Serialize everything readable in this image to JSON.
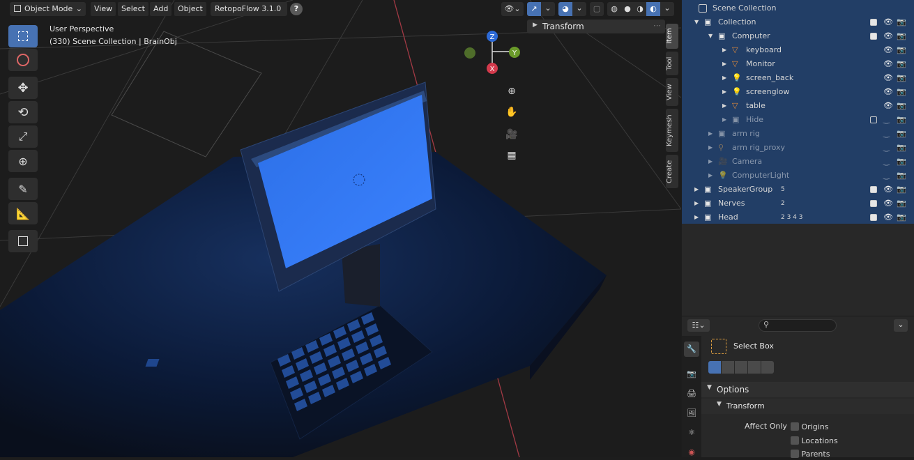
{
  "header": {
    "mode": "Object Mode",
    "menus": [
      "View",
      "Select",
      "Add",
      "Object"
    ],
    "addon": "RetopoFlow 3.1.0",
    "help_icon": "question-icon"
  },
  "overlay": {
    "perspective": "User Perspective",
    "context": "(330) Scene Collection | BrainObj"
  },
  "tools": [
    "select-box-icon",
    "cursor-icon",
    "move-icon",
    "rotate-icon",
    "scale-icon",
    "transform-icon",
    "annotate-icon",
    "measure-icon",
    "add-cube-icon"
  ],
  "gizmo": {
    "z": "Z",
    "y": "Y",
    "x": "X"
  },
  "side_tabs": [
    "Item",
    "Tool",
    "View",
    "Keymesh",
    "Create"
  ],
  "transform_panel": {
    "title": "Transform"
  },
  "outliner": {
    "root": "Scene Collection",
    "rows": [
      {
        "label": "Collection",
        "depth": 1,
        "kind": "collection",
        "checked": true,
        "dim": false
      },
      {
        "label": "Computer",
        "depth": 2,
        "kind": "collection",
        "checked": true,
        "dim": false
      },
      {
        "label": "keyboard",
        "depth": 3,
        "kind": "mesh",
        "checked": null,
        "dim": false
      },
      {
        "label": "Monitor",
        "depth": 3,
        "kind": "mesh",
        "checked": null,
        "dim": false
      },
      {
        "label": "screen_back",
        "depth": 3,
        "kind": "light",
        "checked": null,
        "dim": false
      },
      {
        "label": "screenglow",
        "depth": 3,
        "kind": "light",
        "checked": null,
        "dim": false
      },
      {
        "label": "table",
        "depth": 3,
        "kind": "mesh",
        "checked": null,
        "dim": false
      },
      {
        "label": "Hide",
        "depth": 3,
        "kind": "collection",
        "checked": false,
        "dim": true
      },
      {
        "label": "arm rig",
        "depth": 2,
        "kind": "collection",
        "checked": null,
        "dim": true
      },
      {
        "label": "arm rig_proxy",
        "depth": 2,
        "kind": "armature",
        "checked": null,
        "dim": true
      },
      {
        "label": "Camera",
        "depth": 2,
        "kind": "camera",
        "checked": null,
        "dim": true
      },
      {
        "label": "ComputerLight",
        "depth": 2,
        "kind": "light",
        "checked": null,
        "dim": true
      },
      {
        "label": "SpeakerGroup",
        "depth": 1,
        "kind": "collection",
        "checked": true,
        "dim": false,
        "badge": "5"
      },
      {
        "label": "Nerves",
        "depth": 1,
        "kind": "collection",
        "checked": true,
        "dim": false,
        "badge": "2"
      },
      {
        "label": "Head",
        "depth": 1,
        "kind": "collection",
        "checked": true,
        "dim": false,
        "badge": "2 3 4 3"
      }
    ]
  },
  "properties": {
    "tool_name": "Select Box",
    "options_label": "Options",
    "transform_label": "Transform",
    "affect_only_label": "Affect Only",
    "affect_items": [
      "Origins",
      "Locations",
      "Parents"
    ]
  },
  "colors": {
    "accent": "#4772b3",
    "outliner_bg": "#223e66",
    "mesh_icon": "#e38b3a",
    "data_icon": "#2fb8a6"
  }
}
